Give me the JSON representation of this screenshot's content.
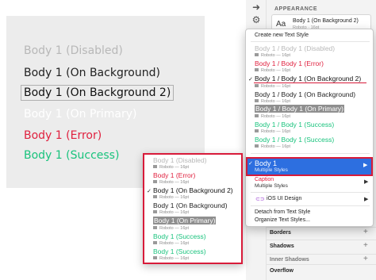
{
  "colors": {
    "disabled": "#b8b8b8",
    "on_background": "#222222",
    "on_primary": "#ffffff",
    "error": "#e0213f",
    "success": "#19c37d",
    "accent": "#2d6fe0",
    "callout": "#d81b3a"
  },
  "canvas": {
    "texts": [
      "Body 1 (Disabled)",
      "Body 1 (On Background)",
      "Body 1 (On Background 2)",
      "Body 1 (On Primary)",
      "Body 1 (Error)",
      "Body 1 (Success)"
    ]
  },
  "inspector": {
    "section_label": "APPEARANCE",
    "style_card": {
      "aa": "Aa",
      "name": "Body 1 (On Background 2)",
      "sub": "Roboto · 16pt"
    },
    "sections": [
      "Borders",
      "Shadows",
      "Inner Shadows",
      "Overflow"
    ]
  },
  "menu": {
    "create": "Create new Text Style",
    "styles": [
      {
        "title": "Body 1 / Body 1 (Disabled)",
        "meta": "Roboto — 16pt"
      },
      {
        "title": "Body 1 / Body 1 (Error)",
        "meta": "Roboto — 16pt"
      },
      {
        "title": "Body 1 / Body 1 (On Background 2)",
        "meta": "Roboto — 16pt"
      },
      {
        "title": "Body 1 / Body 1 (On Background)",
        "meta": "Roboto — 16pt"
      },
      {
        "title": "Body 1 / Body 1 (On Primary)",
        "meta": "Roboto — 16pt"
      },
      {
        "title": "Body 1 / Body 1 (Success)",
        "meta": "Roboto — 16pt"
      },
      {
        "title": "Body 1 / Body 1 (Success)",
        "meta": "Roboto — 16pt"
      }
    ],
    "group_body1": {
      "title": "Body 1",
      "sub": "Multiple Styles"
    },
    "group_caption": {
      "title": "Caption",
      "sub": "Multiple Styles"
    },
    "group_ios": {
      "title": "iOS UI Design"
    },
    "detach": "Detach from Text Style",
    "organize": "Organize Text Styles..."
  },
  "submenu": {
    "styles": [
      {
        "title": "Body 1 (Disabled)",
        "meta": "Roboto — 16pt"
      },
      {
        "title": "Body 1 (Error)",
        "meta": "Roboto — 16pt"
      },
      {
        "title": "Body 1 (On Background 2)",
        "meta": "Roboto — 16pt"
      },
      {
        "title": "Body 1 (On Background)",
        "meta": "Roboto — 16pt"
      },
      {
        "title": "Body 1 (On Primary)",
        "meta": "Roboto — 16pt"
      },
      {
        "title": "Body 1 (Success)",
        "meta": "Roboto — 16pt"
      },
      {
        "title": "Body 1 (Success)",
        "meta": "Roboto — 16pt"
      }
    ]
  }
}
